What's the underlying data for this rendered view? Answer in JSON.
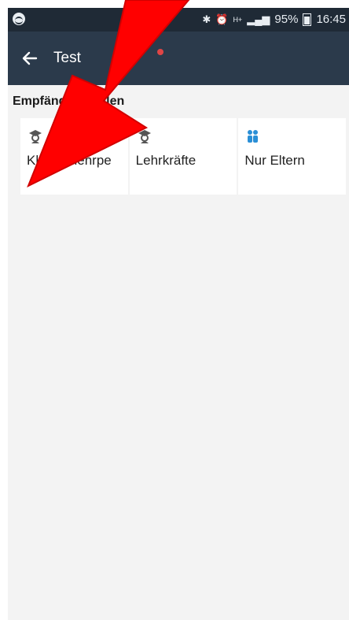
{
  "status_bar": {
    "battery": "95%",
    "time": "16:45",
    "network": "H+",
    "icons": [
      "spotify-icon",
      "bluetooth-icon",
      "alarm-icon",
      "signal-icon",
      "battery-icon"
    ]
  },
  "app_bar": {
    "title": "Test",
    "back_icon": "arrow-left-icon",
    "colors": {
      "status": "#1f2a36",
      "bar": "#2b3a4b",
      "dot": "#e04545"
    }
  },
  "section": {
    "label": "Empfänger wählen"
  },
  "options": [
    {
      "label": "Klassenlehrpe",
      "icon": "graduation-teacher-icon",
      "icon_color": "#555555"
    },
    {
      "label": "Lehrkräfte",
      "icon": "graduation-teacher-icon",
      "icon_color": "#555555"
    },
    {
      "label": "Nur Eltern",
      "icon": "parents-icon",
      "icon_color": "#2a8fd6"
    }
  ],
  "annotation": {
    "arrow_color": "#ff0000"
  }
}
